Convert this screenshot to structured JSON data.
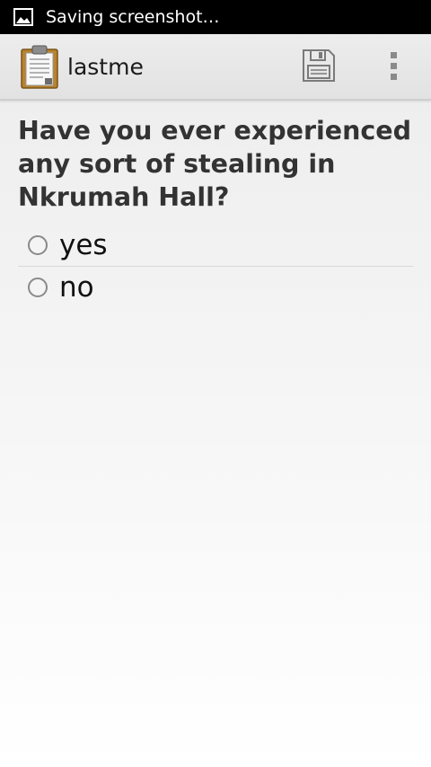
{
  "status_bar": {
    "notification_icon": "image-icon",
    "text": "Saving screenshot…"
  },
  "action_bar": {
    "app_icon": "clipboard-icon",
    "title": "lastme",
    "save_icon": "floppy-disk-icon",
    "overflow_icon": "overflow-menu-icon"
  },
  "question": {
    "text": "Have you ever experienced any sort of stealing in Nkrumah Hall?",
    "options": [
      {
        "label": "yes",
        "selected": false
      },
      {
        "label": "no",
        "selected": false
      }
    ]
  },
  "colors": {
    "status_bar_bg": "#000000",
    "action_bar_bg": "#e6e6e6",
    "question_text": "#333333"
  }
}
